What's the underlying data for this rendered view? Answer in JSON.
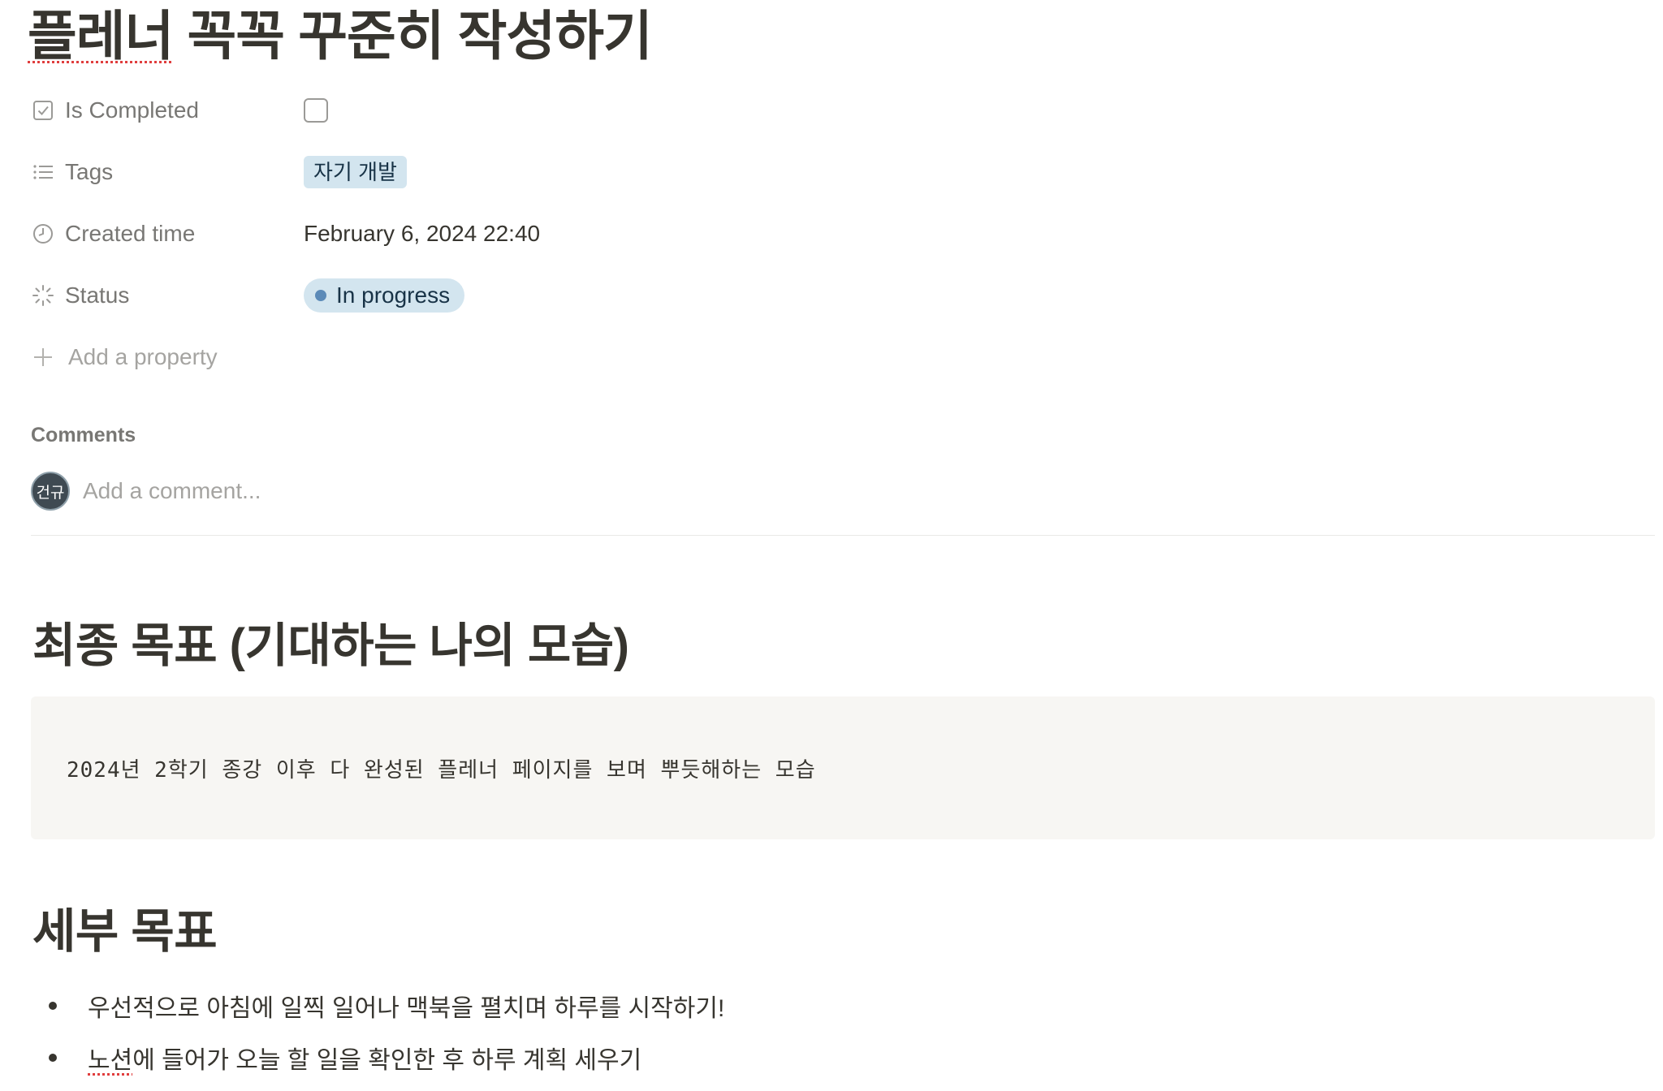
{
  "page": {
    "title": "플레너 꼭꼭 꾸준히 작성하기",
    "title_first_word": "플레너",
    "title_rest": " 꼭꼭 꾸준히 작성하기"
  },
  "properties": {
    "is_completed": {
      "label": "Is Completed",
      "checked": false,
      "icon": "checkbox-icon"
    },
    "tags": {
      "label": "Tags",
      "value": "자기 개발",
      "icon": "list-icon"
    },
    "created_time": {
      "label": "Created time",
      "value": "February 6, 2024 22:40",
      "icon": "clock-icon"
    },
    "status": {
      "label": "Status",
      "value": "In progress",
      "icon": "loading-spinner-icon"
    },
    "add_property_label": "Add a property"
  },
  "comments": {
    "label": "Comments",
    "avatar_initials": "건규",
    "placeholder": "Add a comment..."
  },
  "sections": {
    "final_goal": {
      "heading": "최종 목표 (기대하는 나의 모습)",
      "code_text": "2024년 2학기 종강 이후 다 완성된 플레너 페이지를 보며 뿌듯해하는 모습"
    },
    "detailed_goals": {
      "heading": "세부 목표",
      "items": [
        {
          "text": "우선적으로 아침에 일찍 일어나 맥북을 펼치며 하루를 시작하기!"
        },
        {
          "first_word": "노션",
          "rest": "에 들어가 오늘 할 일을 확인한 후 하루 계획 세우기"
        }
      ]
    }
  },
  "colors": {
    "text": "#37352f",
    "muted": "#787774",
    "tag_bg": "#d3e5ef",
    "status_dot": "#5b8ab8",
    "code_bg": "#f7f6f3"
  }
}
